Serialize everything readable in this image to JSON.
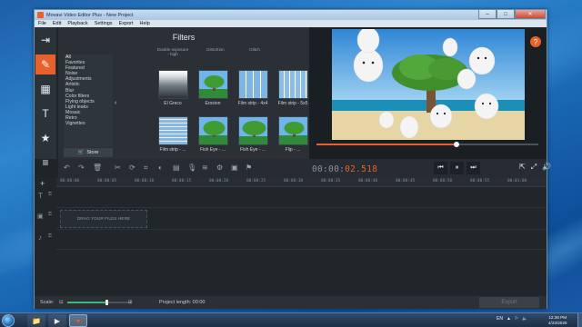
{
  "window": {
    "title": "Movavi Video Editor Plus - New Project",
    "controls": {
      "minimize": "–",
      "maximize": "□",
      "close": "✕"
    }
  },
  "menu": [
    "File",
    "Edit",
    "Playback",
    "Settings",
    "Export",
    "Help"
  ],
  "rail": [
    {
      "icon": "import-icon",
      "glyph": "⇥"
    },
    {
      "icon": "filters-icon",
      "glyph": "✎",
      "active": true
    },
    {
      "icon": "transitions-icon",
      "glyph": "▦"
    },
    {
      "icon": "titles-icon",
      "glyph": "T"
    },
    {
      "icon": "stickers-icon",
      "glyph": "★"
    },
    {
      "icon": "more-tools-icon",
      "glyph": "≡"
    }
  ],
  "filters": {
    "title": "Filters",
    "categories": [
      "All",
      "Favorites",
      "Featured",
      "Noise",
      "Adjustments",
      "Artistic",
      "Blur",
      "Color filters",
      "Flying objects",
      "Light leaks",
      "Mosaic",
      "Retro",
      "Vignettes"
    ],
    "selected_category": "All",
    "store_label": "Store",
    "top_row_labels": [
      "Double exposure - high",
      "Distortion",
      "Glitch"
    ],
    "row1": [
      "El Greco",
      "Erosion",
      "Film strip - 4x4",
      "Film strip - 5x5"
    ],
    "row2": [
      "Film strip - ...",
      "Fish Eye - ...",
      "Fish Eye - ...",
      "Flip - ..."
    ]
  },
  "player": {
    "help_label": "?",
    "progress": 0.63
  },
  "controls": {
    "timecode_dim": "00:00:",
    "timecode_red": "02.518",
    "transport": [
      "⏮",
      "⏸",
      "⏭"
    ],
    "right_tools": [
      "⇱",
      "⤢",
      "🔊"
    ]
  },
  "timeline": {
    "ruler": [
      "00:00:00",
      "00:00:05",
      "00:00:10",
      "00:00:15",
      "00:00:20",
      "00:00:25",
      "00:00:30",
      "00:00:35",
      "00:00:40",
      "00:00:45",
      "00:00:50",
      "00:00:55",
      "00:01:00"
    ],
    "drop_label": "DRAG YOUR FILES HERE"
  },
  "status": {
    "scale_label": "Scale:",
    "scale_value": 0.62,
    "project_length": "Project length:  00:00",
    "export_label": "Export"
  },
  "taskbar": {
    "language": "EN",
    "time": "12:36 PM",
    "date": "4/23/2020"
  }
}
